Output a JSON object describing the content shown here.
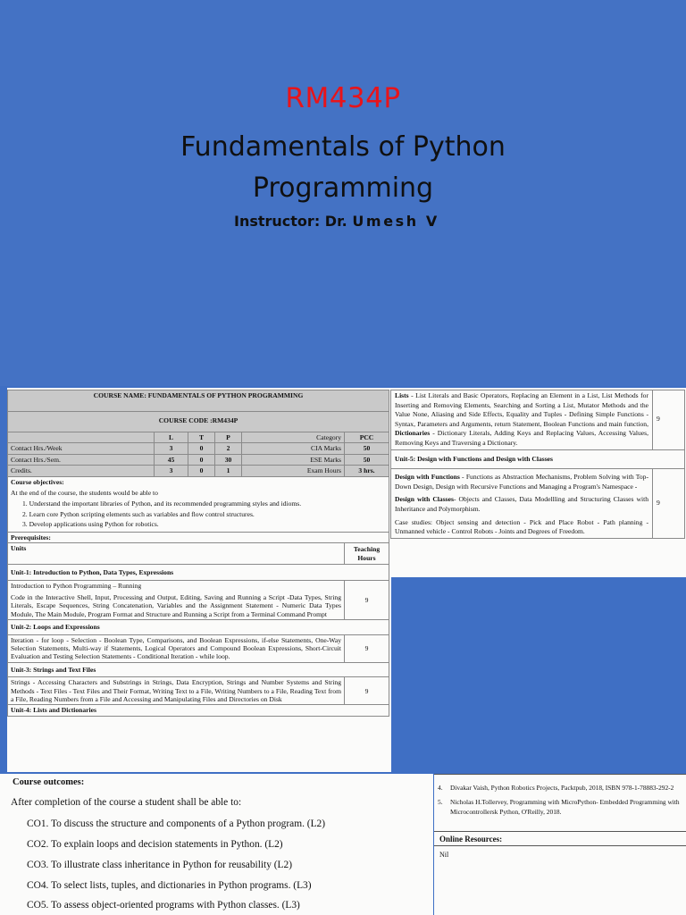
{
  "slide": {
    "code": "RM434P",
    "title_line1": "Fundamentals of Python",
    "title_line2": "Programming",
    "instructor_label": "Instructor: Dr.",
    "instructor_name": "Umesh V"
  },
  "syllabus": {
    "course_name": "COURSE NAME: FUNDAMENTALS OF PYTHON PROGRAMMING",
    "course_code": "COURSE CODE :RM434P",
    "ltp_headers": [
      "L",
      "T",
      "P"
    ],
    "category_label": "Category",
    "category_value": "PCC",
    "rows": [
      {
        "label": "Contact Hrs./Week",
        "l": "3",
        "t": "0",
        "p": "2",
        "key": "CIA Marks",
        "value": "50"
      },
      {
        "label": "Contact Hrs./Sem.",
        "l": "45",
        "t": "0",
        "p": "30",
        "key": "ESE Marks",
        "value": "50"
      },
      {
        "label": "Credits.",
        "l": "3",
        "t": "0",
        "p": "1",
        "key": "Exam Hours",
        "value": "3 hrs."
      }
    ],
    "objectives_title": "Course objectives:",
    "objectives_intro": "At the end of the course, the students would be able to",
    "objectives": [
      "1.   Understand the important libraries of Python, and its recommended programming styles and idioms.",
      "2.   Learn core Python scripting elements such as variables and flow control structures.",
      "3.   Develop applications using Python for robotics."
    ],
    "prerequisites": "Prerequisites:",
    "units_header": "Units",
    "hours_header": "Teaching Hours",
    "units": [
      {
        "title": "Unit-1: Introduction to Python, Data Types, Expressions",
        "lead": "Introduction to Python Programming – Running",
        "body": "Code in the Interactive Shell, Input, Processing and Output, Editing, Saving and Running a Script -Data Types, String Literals, Escape Sequences, String Concatenation, Variables and the Assignment Statement - Numeric Data Types Module, The Main Module, Program Format and Structure and Running a Script from a Terminal Command Prompt",
        "hours": "9"
      },
      {
        "title": "Unit-2: Loops and Expressions",
        "lead": "",
        "body": "Iteration - for loop - Selection - Boolean Type, Comparisons, and Boolean Expressions, if-else Statements, One-Way Selection Statements, Multi-way if Statements, Logical Operators and Compound Boolean Expressions, Short-Circuit Evaluation and Testing Selection Statements - Conditional Iteration - while loop.",
        "hours": "9"
      },
      {
        "title": "Unit-3: Strings and Text Files",
        "lead": "",
        "body": "Strings - Accessing Characters and Substrings in Strings, Data Encryption, Strings and Number Systems and String Methods - Text Files - Text Files and Their Format, Writing Text to a File, Writing Numbers to a File, Reading Text from a File, Reading Numbers from a File and Accessing and Manipulating Files and Directories on Disk",
        "hours": "9"
      },
      {
        "title": "Unit-4: Lists and Dictionaries",
        "lead": "",
        "body": "",
        "hours": ""
      }
    ]
  },
  "syllabus_cont": {
    "unit4_label": "Lists",
    "unit4_body_a": " - List Literals and Basic Operators, Replacing an Element in a List, List Methods for Inserting and Removing Elements, Searching and Sorting a List, Mutator Methods and the Value None, Aliasing and Side Effects, Equality and Tuples - Defining Simple Functions - Syntax, Parameters and Arguments, return Statement, Boolean Functions and main function, ",
    "unit4_dict_label": "Dictionaries",
    "unit4_body_b": " - Dictionary Literals, Adding Keys and Replacing Values, Accessing Values, Removing Keys and Traversing a Dictionary.",
    "unit4_hours": "9",
    "unit5_title": "Unit-5: Design with Functions and Design with Classes",
    "unit5_func_label": "Design with Functions",
    "unit5_func_body": " - Functions as Abstraction Mechanisms, Problem Solving with Top-Down Design, Design with Recursive Functions and Managing a Program's Namespace -",
    "unit5_class_label": "Design with Classes",
    "unit5_class_body": "- Objects and Classes, Data Modellling and Structuring Classes with Inheritance and Polymorphism.",
    "unit5_case": "Case studies: Object sensing and detection - Pick and Place Robot - Path planning - Unmanned vehicle - Control Robots - Joints and Degrees of Freedom.",
    "unit5_hours": "9"
  },
  "outcomes": {
    "title": "Course outcomes:",
    "intro": "After completion of the course a student shall be able to:",
    "items": [
      "CO1. To discuss the structure and components of a Python program. (L2)",
      "CO2. To explain loops and decision statements in Python. (L2)",
      "CO3. To illustrate class inheritance in Python for reusability (L2)",
      "CO4. To select lists, tuples, and dictionaries in Python programs. (L3)",
      "CO5. To assess object-oriented programs with Python classes. (L3)"
    ]
  },
  "references": {
    "items": [
      {
        "num": "4.",
        "text": "Divakar Vaish, Python Robotics Projects, Packtpub, 2018, ISBN 978-1-78883-292-2"
      },
      {
        "num": "5.",
        "text": "Nicholas H.Tollervey, Programming with MicroPython- Embedded Programming with Microcontrollersk Python, O'Reilly, 2018."
      }
    ],
    "online_title": "Online Resources:",
    "online_value": "Nil"
  }
}
